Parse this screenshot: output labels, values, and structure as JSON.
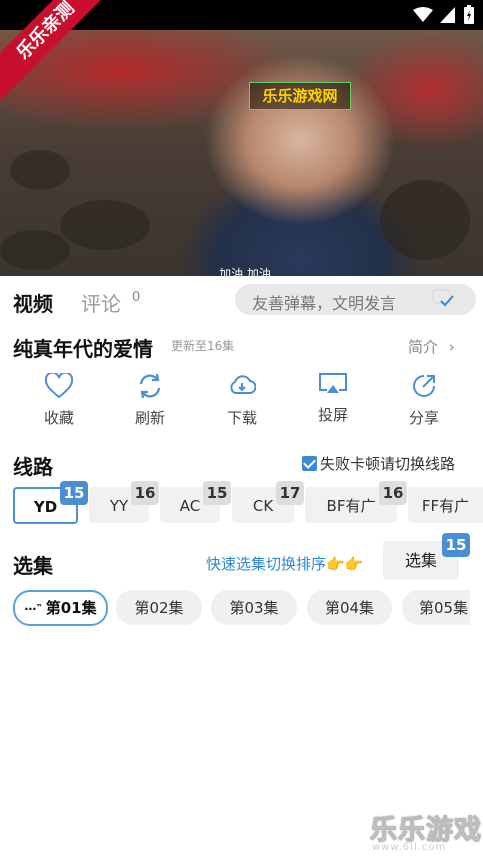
{
  "status": {
    "icons": [
      "wifi-icon",
      "signal-icon",
      "battery-icon"
    ]
  },
  "video": {
    "ribbon": "乐乐亲测",
    "watermark": "乐乐游戏网",
    "subtitle": "加油 加油"
  },
  "tabs": {
    "video": "视频",
    "comments": "评论",
    "comment_count": "0"
  },
  "danmu": {
    "placeholder": "友善弹幕，文明发言"
  },
  "show": {
    "title": "纯真年代的爱情",
    "update": "更新至16集",
    "intro": "简介"
  },
  "actions": [
    {
      "label": "收藏",
      "icon": "heart-icon"
    },
    {
      "label": "刷新",
      "icon": "refresh-icon"
    },
    {
      "label": "下载",
      "icon": "download-icon"
    },
    {
      "label": "投屏",
      "icon": "cast-icon"
    },
    {
      "label": "分享",
      "icon": "share-icon"
    }
  ],
  "lines": {
    "title": "线路",
    "fail_switch": "失败卡顿请切换线路",
    "items": [
      {
        "label": "YD",
        "count": "15",
        "active": true
      },
      {
        "label": "YY",
        "count": "16"
      },
      {
        "label": "AC",
        "count": "15"
      },
      {
        "label": "CK",
        "count": "17"
      },
      {
        "label": "BF有广",
        "count": "16"
      },
      {
        "label": "FF有广",
        "count": ""
      }
    ]
  },
  "episodes": {
    "title": "选集",
    "sort_link": "快速选集切换排序👉👉",
    "select_button": "选集",
    "select_badge": "15",
    "playing_indicator": "⋯‶",
    "items": [
      "第01集",
      "第02集",
      "第03集",
      "第04集",
      "第05集"
    ]
  },
  "bottom_watermark": {
    "main": "乐乐游戏",
    "sub": "www.6ll.com"
  },
  "colors": {
    "accent": "#4a8fd3",
    "link": "#2f87d0",
    "ribbon": "#c8102e"
  }
}
